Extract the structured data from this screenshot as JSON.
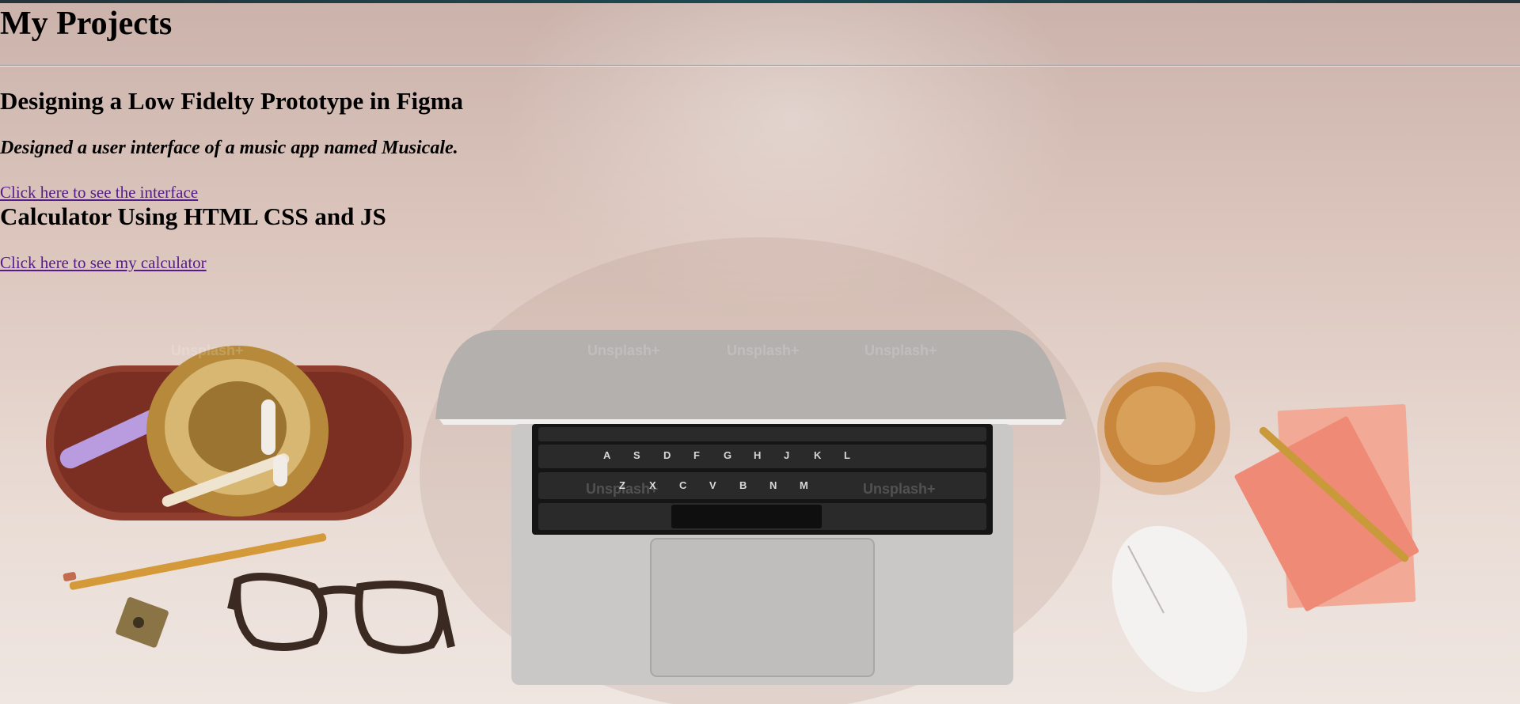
{
  "page": {
    "title": "My Projects"
  },
  "projects": [
    {
      "title": "Designing a Low Fidelty Prototype in Figma",
      "description": "Designed a user interface of a music app named Musicale.",
      "link_label": "Click here to see the interface"
    },
    {
      "title": "Calculator Using HTML CSS and JS",
      "link_label": "Click here to see my calculator"
    }
  ],
  "background": {
    "watermark": "Unsplash+",
    "keyboard_keys": [
      "A",
      "S",
      "D",
      "F",
      "G",
      "H",
      "J",
      "K",
      "L",
      "Z",
      "X",
      "C",
      "V",
      "B",
      "N",
      "M"
    ],
    "colors": {
      "link": "#551a8b",
      "tray": "#8a3a2a",
      "notepad": "#f08a78",
      "laptop": "#c9c6c4",
      "keyboard": "#181818"
    }
  }
}
